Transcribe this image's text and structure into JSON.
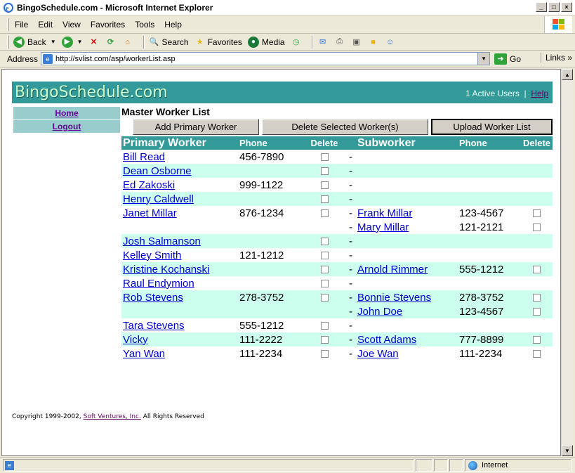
{
  "window": {
    "title": "BingoSchedule.com - Microsoft Internet Explorer",
    "controls": [
      "_",
      "□",
      "×"
    ]
  },
  "menu": [
    "File",
    "Edit",
    "View",
    "Favorites",
    "Tools",
    "Help"
  ],
  "toolbar": {
    "back": "Back",
    "search": "Search",
    "favorites": "Favorites",
    "media": "Media"
  },
  "address": {
    "label": "Address",
    "url": "http://svlist.com/asp/workerList.asp",
    "go": "Go",
    "links": "Links"
  },
  "header": {
    "logo": "BingoSchedule.com",
    "active_users": "1 Active Users",
    "separator": "|",
    "help": "Help"
  },
  "nav": [
    {
      "label": "Home"
    },
    {
      "label": "Logout"
    }
  ],
  "main": {
    "title": "Master Worker List",
    "buttons": {
      "add_primary": "Add Primary Worker",
      "delete_selected": "Delete Selected Worker(s)",
      "upload": "Upload Worker List"
    },
    "columns": {
      "primary": "Primary Worker",
      "phone": "Phone",
      "delete": "Delete",
      "subworker": "Subworker",
      "sub_phone": "Phone",
      "sub_delete": "Delete"
    }
  },
  "rows": [
    {
      "primary": "Bill Read",
      "phone": "456-7890",
      "sub": "",
      "sub_phone": "",
      "alt": false
    },
    {
      "primary": "Dean Osborne",
      "phone": "",
      "sub": "",
      "sub_phone": "",
      "alt": true
    },
    {
      "primary": "Ed Zakoski",
      "phone": "999-1122",
      "sub": "",
      "sub_phone": "",
      "alt": false
    },
    {
      "primary": "Henry Caldwell",
      "phone": "",
      "sub": "",
      "sub_phone": "",
      "alt": true
    },
    {
      "primary": "Janet Millar",
      "phone": "876-1234",
      "sub": "Frank Millar",
      "sub_phone": "123-4567",
      "alt": false
    },
    {
      "primary": "",
      "phone": "",
      "sub": "Mary Millar",
      "sub_phone": "121-2121",
      "alt": false,
      "continuation": true
    },
    {
      "primary": "Josh Salmanson",
      "phone": "",
      "sub": "",
      "sub_phone": "",
      "alt": true
    },
    {
      "primary": "Kelley Smith",
      "phone": "121-1212",
      "sub": "",
      "sub_phone": "",
      "alt": false
    },
    {
      "primary": "Kristine Kochanski",
      "phone": "",
      "sub": "Arnold Rimmer",
      "sub_phone": "555-1212",
      "alt": true
    },
    {
      "primary": "Raul Endymion",
      "phone": "",
      "sub": "",
      "sub_phone": "",
      "alt": false
    },
    {
      "primary": "Rob Stevens",
      "phone": "278-3752",
      "sub": "Bonnie Stevens",
      "sub_phone": "278-3752",
      "alt": true
    },
    {
      "primary": "",
      "phone": "",
      "sub": "John Doe",
      "sub_phone": "123-4567",
      "alt": true,
      "continuation": true
    },
    {
      "primary": "Tara Stevens",
      "phone": "555-1212",
      "sub": "",
      "sub_phone": "",
      "alt": false
    },
    {
      "primary": "Vicky",
      "phone": "111-2222",
      "sub": "Scott Adams",
      "sub_phone": "777-8899",
      "alt": true
    },
    {
      "primary": "Yan Wan",
      "phone": "111-2234",
      "sub": "Joe Wan",
      "sub_phone": "111-2234",
      "alt": false
    }
  ],
  "footer": {
    "prefix": "Copyright 1999-2002,",
    "company": "Soft Ventures, Inc.",
    "suffix": "All Rights Reserved"
  },
  "status": {
    "zone": "Internet"
  },
  "colors": {
    "teal": "#339999",
    "mint": "#ccffee",
    "nav": "#99cccc",
    "link": "#0000cc",
    "visited": "#660099"
  }
}
